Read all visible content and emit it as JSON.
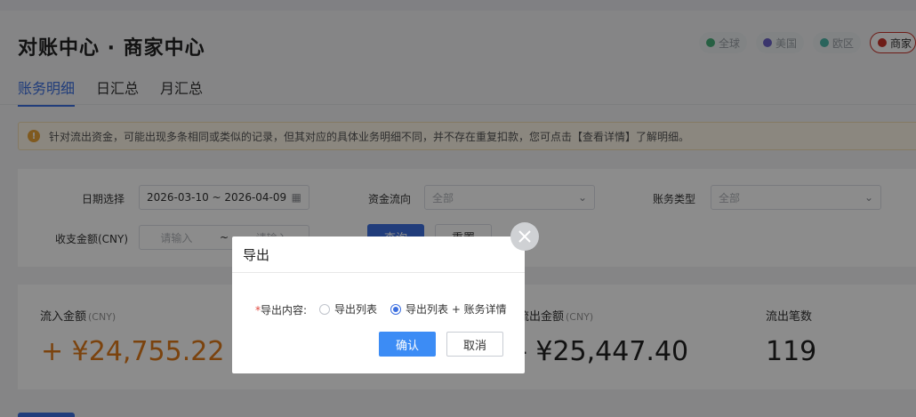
{
  "app": {
    "title": "对账中心 · 商家中心"
  },
  "regions": [
    {
      "label": "全球",
      "color": "#47b07a"
    },
    {
      "label": "美国",
      "color": "#6c63c7"
    },
    {
      "label": "欧区",
      "color": "#4db6a8"
    },
    {
      "label": "商家",
      "color": "#c8332b"
    }
  ],
  "tabs": [
    {
      "label": "账务明细",
      "active": true
    },
    {
      "label": "日汇总",
      "active": false
    },
    {
      "label": "月汇总",
      "active": false
    }
  ],
  "notice": {
    "icon": "!",
    "text": "针对流出资金，可能出现多条相同或类似的记录，但其对应的具体业务明细不同，并不存在重复扣款，您可点击【查看详情】了解明细。"
  },
  "filters": {
    "date_label": "日期选择",
    "date_value": "2026-03-10 ~ 2026-04-09",
    "flow_label": "资金流向",
    "flow_value": "全部",
    "type_label": "账务类型",
    "type_value": "全部",
    "amount_label": "收支金额(CNY)",
    "amount_min_placeholder": "请输入",
    "amount_separator": "~",
    "amount_max_placeholder": "请输入",
    "query_label": "查询",
    "reset_label": "重置"
  },
  "stats": {
    "inflow_label": "流入金额",
    "inflow_unit": "(CNY)",
    "inflow_value": "+ ¥24,755.22",
    "inflow_color": "#e07b1a",
    "outflow_label": "流出金额",
    "outflow_unit": "(CNY)",
    "outflow_value": "- ¥25,447.40",
    "outflow_count_label": "流出笔数",
    "outflow_count_value": "119"
  },
  "modal": {
    "title": "导出",
    "field_label": "导出内容:",
    "required_mark": "*",
    "options": [
      {
        "label": "导出列表",
        "checked": false
      },
      {
        "label": "导出列表 + 账务详情",
        "checked": true
      }
    ],
    "ok_label": "确认",
    "cancel_label": "取消"
  }
}
